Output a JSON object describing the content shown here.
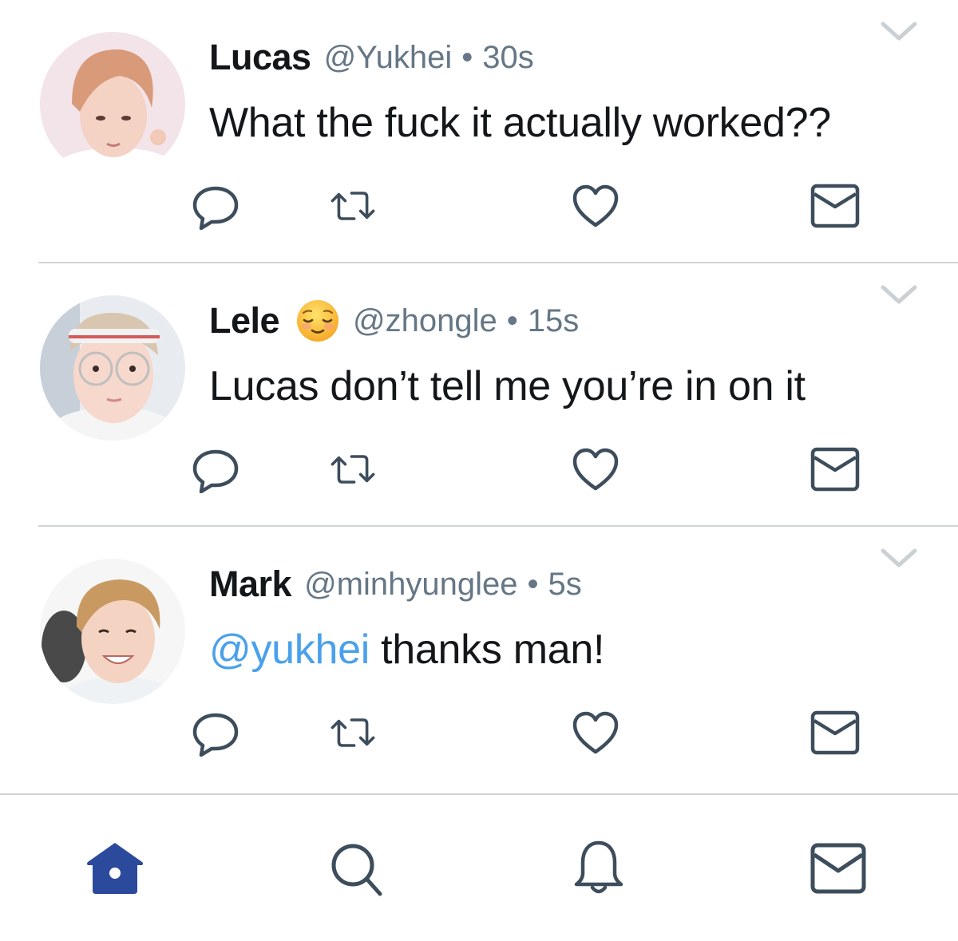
{
  "colors": {
    "text": "#14171a",
    "secondary": "#657786",
    "mention": "#4aa1eb",
    "icon": "#3d4d5c",
    "home_active": "#2c4a9c",
    "divider": "#cfd4d8"
  },
  "tweets": [
    {
      "name": "Lucas",
      "handle": "@Yukhei",
      "separator": "•",
      "time": "30s",
      "text": "What the fuck it actually worked??",
      "mention": "",
      "emoji": ""
    },
    {
      "name": "Lele",
      "handle": "@zhongle",
      "separator": "•",
      "time": "15s",
      "text": "Lucas don’t tell me you’re in on it",
      "mention": "",
      "emoji": "relieved-face"
    },
    {
      "name": "Mark",
      "handle": "@minhyunglee",
      "separator": "•",
      "time": "5s",
      "mention": "@yukhei",
      "text": " thanks man!",
      "emoji": ""
    }
  ],
  "action_icons": [
    "reply-icon",
    "retweet-icon",
    "like-icon",
    "direct-message-icon"
  ],
  "tabbar": {
    "tabs": [
      "home-icon",
      "search-icon",
      "notifications-icon",
      "messages-icon"
    ],
    "active": "home-icon"
  }
}
